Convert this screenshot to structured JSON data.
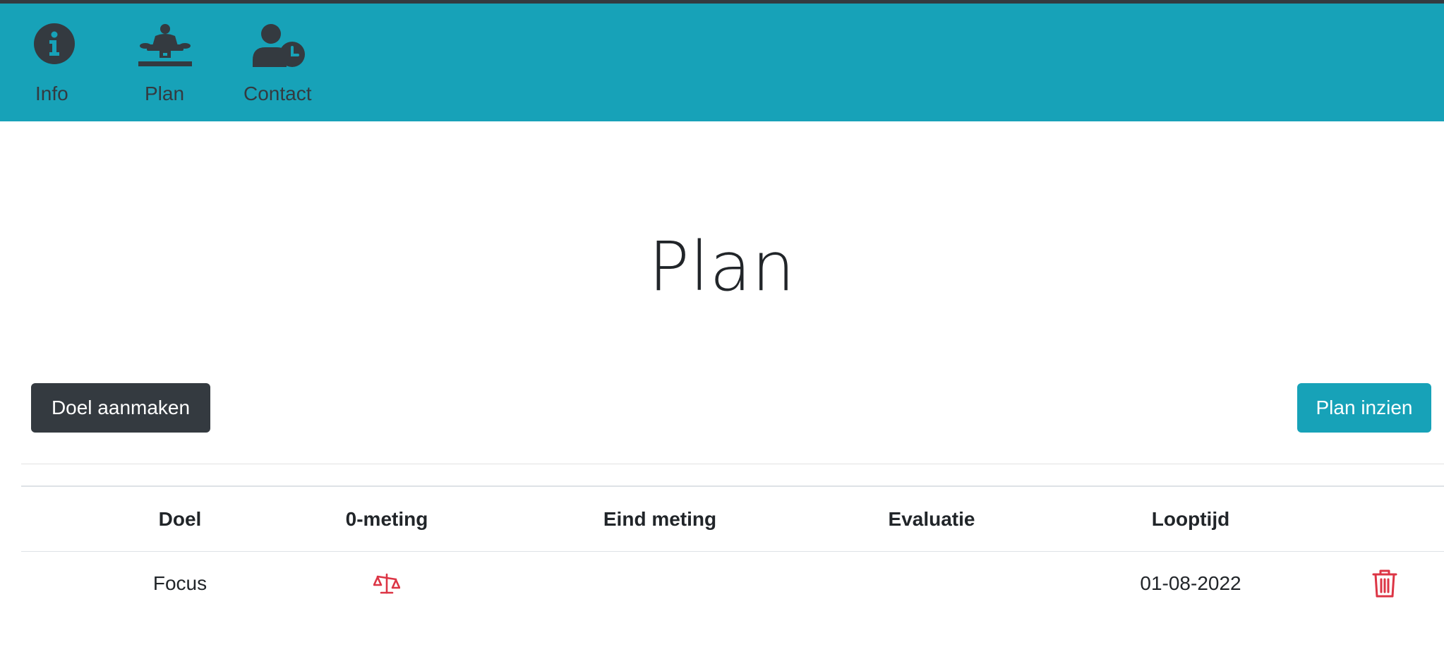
{
  "nav": {
    "items": [
      {
        "label": "Info",
        "icon": "info-circle-icon"
      },
      {
        "label": "Plan",
        "icon": "therapist-bed-icon"
      },
      {
        "label": "Contact",
        "icon": "user-clock-icon"
      }
    ]
  },
  "page": {
    "title": "Plan"
  },
  "actions": {
    "create_goal_label": "Doel aanmaken",
    "view_plan_label": "Plan inzien"
  },
  "table": {
    "headers": [
      "Doel",
      "0-meting",
      "Eind meting",
      "Evaluatie",
      "Looptijd"
    ],
    "rows": [
      {
        "doel": "Focus",
        "nulmeting_icon": "balance-scale-icon",
        "eind_meting": "",
        "evaluatie": "",
        "looptijd": "01-08-2022",
        "action_icon": "trash-icon"
      }
    ]
  },
  "colors": {
    "navbar": "#17a2b8",
    "dark": "#343a40",
    "danger": "#dc3545",
    "info": "#17a2b8"
  }
}
